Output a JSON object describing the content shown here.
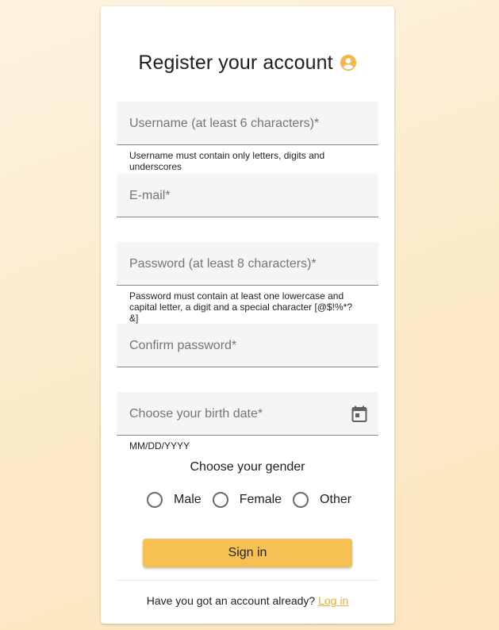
{
  "form": {
    "title": "Register your account",
    "username_label": "Username (at least 6 characters)*",
    "username_hint": "Username must contain only letters, digits and underscores",
    "email_label": "E-mail*",
    "password_label": "Password (at least 8 characters)*",
    "password_hint_line1": "Password must contain at least one lowercase and",
    "password_hint_line2": "capital letter, a digit and a special character [@$!%*?",
    "password_hint_line3": "&]",
    "confirm_password_label": "Confirm password*",
    "birth_date_label": "Choose your birth date*",
    "birth_date_hint": "MM/DD/YYYY",
    "gender_title": "Choose your gender",
    "gender_options": [
      "Male",
      "Female",
      "Other"
    ],
    "submit_label": "Sign in",
    "footer_text": "Have you got an account already?",
    "footer_link": "Log in"
  },
  "icons": {
    "title_icon": "account-circle-icon",
    "date_icon": "calendar-icon"
  },
  "colors": {
    "accent": "#f6c052",
    "link": "#f0a93a",
    "background": "#fbe9c6"
  }
}
